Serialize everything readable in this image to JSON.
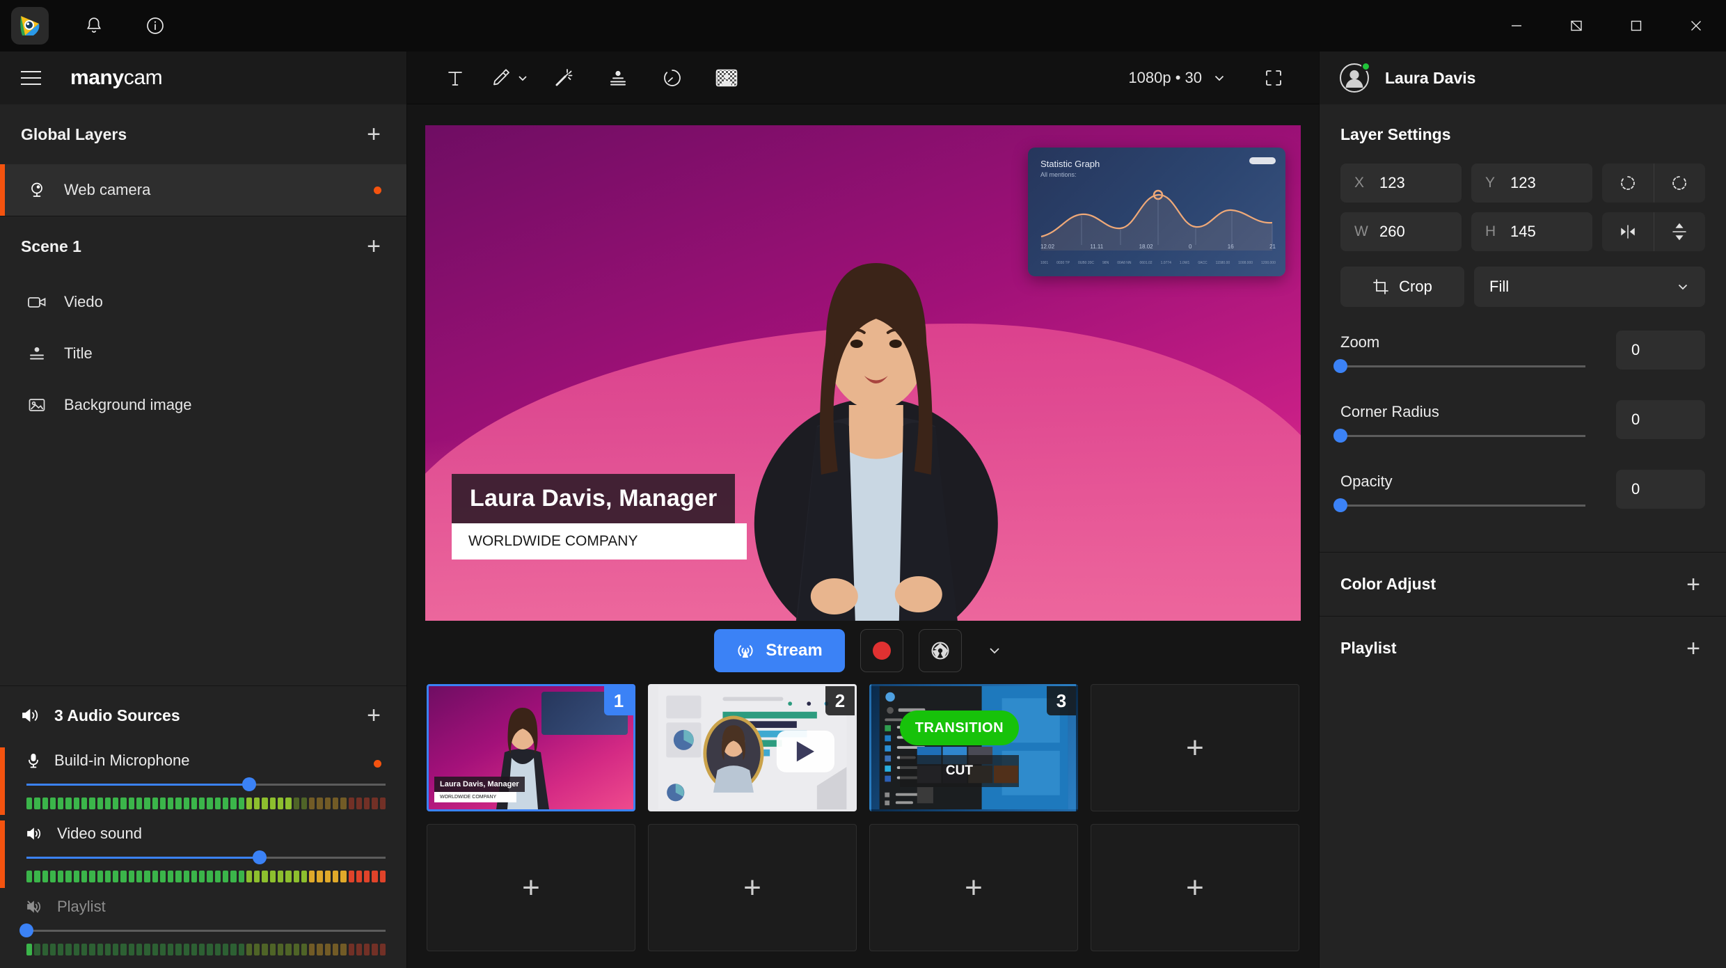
{
  "titlebar": {
    "icons": [
      "app-logo",
      "bell-icon",
      "info-icon"
    ],
    "window_controls": [
      "minimize",
      "restore-down",
      "maximize",
      "close"
    ]
  },
  "sidebar": {
    "logo_bold": "many",
    "logo_light": "cam",
    "global_layers": {
      "title": "Global Layers",
      "add_label": "+",
      "items": [
        {
          "label": "Web camera",
          "icon": "webcam-icon",
          "active": true,
          "live": true
        }
      ]
    },
    "scene": {
      "title": "Scene 1",
      "add_label": "+",
      "items": [
        {
          "label": "Viedo",
          "icon": "video-camera-icon"
        },
        {
          "label": "Title",
          "icon": "title-icon"
        },
        {
          "label": "Background image",
          "icon": "image-icon"
        }
      ]
    },
    "audio": {
      "title": "3 Audio Sources",
      "add_label": "+",
      "sources": [
        {
          "label": "Build-in Microphone",
          "icon": "microphone-icon",
          "volume": 62,
          "muted": false,
          "live": true,
          "meter_level": 74
        },
        {
          "label": "Video sound",
          "icon": "speaker-icon",
          "volume": 65,
          "muted": false,
          "live": false,
          "meter_level": 100
        },
        {
          "label": "Playlist",
          "icon": "speaker-muted-icon",
          "volume": 0,
          "muted": true,
          "live": false,
          "meter_level": 0
        }
      ]
    }
  },
  "toolbar": {
    "tools": [
      {
        "name": "text-tool",
        "icon": "text-icon"
      },
      {
        "name": "draw-tool",
        "icon": "pencil-icon",
        "has_chevron": true
      },
      {
        "name": "effects-tool",
        "icon": "magic-wand-icon"
      },
      {
        "name": "lower-third-tool",
        "icon": "person-lines-icon"
      },
      {
        "name": "timer-tool",
        "icon": "stopwatch-icon"
      },
      {
        "name": "background-tool",
        "icon": "chroma-key-icon"
      }
    ],
    "resolution": "1080p • 30",
    "fullscreen_icon": "fullscreen-icon"
  },
  "preview": {
    "graph_card": {
      "title": "Statistic Graph",
      "subtitle": "All mentions:",
      "x_labels": [
        "12.02",
        "11.11",
        "18.02",
        "0",
        "16",
        "21"
      ],
      "micro_labels": [
        "1001",
        "0030 TP",
        "0UB0 20C",
        "98N",
        "00A8 NN",
        "0601.02",
        "1.0774",
        "1.0W1",
        "0ACC",
        "11580.00",
        "1008.000",
        "1200.000"
      ]
    },
    "lower_third": {
      "name": "Laura Davis, Manager",
      "company": "WORLDWIDE COMPANY"
    }
  },
  "stream_bar": {
    "stream_label": "Stream",
    "stream_icon": "broadcast-icon",
    "record_icon": "record-dot-icon",
    "snapshot_icon": "shutter-icon",
    "more_icon": "chevron-down-icon",
    "stream_color": "#3b82f6",
    "record_color": "#e03131"
  },
  "scenes": [
    {
      "number": "1",
      "type": "presenter",
      "selected": true,
      "name": "Laura Davis, Manager",
      "company": "WORLDWIDE COMPANY"
    },
    {
      "number": "2",
      "type": "dashboard-video",
      "selected": false,
      "play_icon": "play-icon"
    },
    {
      "number": "3",
      "type": "desktop-transition",
      "selected": false,
      "transition_label": "TRANSITION",
      "cut_label": "CUT"
    },
    {
      "number": "",
      "type": "empty",
      "selected": false,
      "add_label": "+"
    },
    {
      "number": "",
      "type": "empty",
      "selected": false,
      "add_label": "+"
    },
    {
      "number": "",
      "type": "empty",
      "selected": false,
      "add_label": "+"
    },
    {
      "number": "",
      "type": "empty",
      "selected": false,
      "add_label": "+"
    },
    {
      "number": "",
      "type": "empty",
      "selected": false,
      "add_label": "+"
    }
  ],
  "right_panel": {
    "user": {
      "name": "Laura Davis",
      "status_color": "#21c43a"
    },
    "layer_settings_title": "Layer Settings",
    "fields": {
      "x_key": "X",
      "x_value": "123",
      "y_key": "Y",
      "y_value": "123",
      "w_key": "W",
      "w_value": "260",
      "h_key": "H",
      "h_value": "145"
    },
    "transform_icons": [
      "rotate-left-icon",
      "rotate-right-icon",
      "flip-horizontal-icon",
      "flip-vertical-icon"
    ],
    "crop_label": "Crop",
    "crop_icon": "crop-icon",
    "fit_mode": "Fill",
    "sliders": [
      {
        "label": "Zoom",
        "value": "0",
        "percent": 0
      },
      {
        "label": "Corner Radius",
        "value": "0",
        "percent": 0
      },
      {
        "label": "Opacity",
        "value": "0",
        "percent": 0
      }
    ],
    "sections": [
      {
        "title": "Color Adjust",
        "add_label": "+"
      },
      {
        "title": "Playlist",
        "add_label": "+"
      }
    ]
  }
}
